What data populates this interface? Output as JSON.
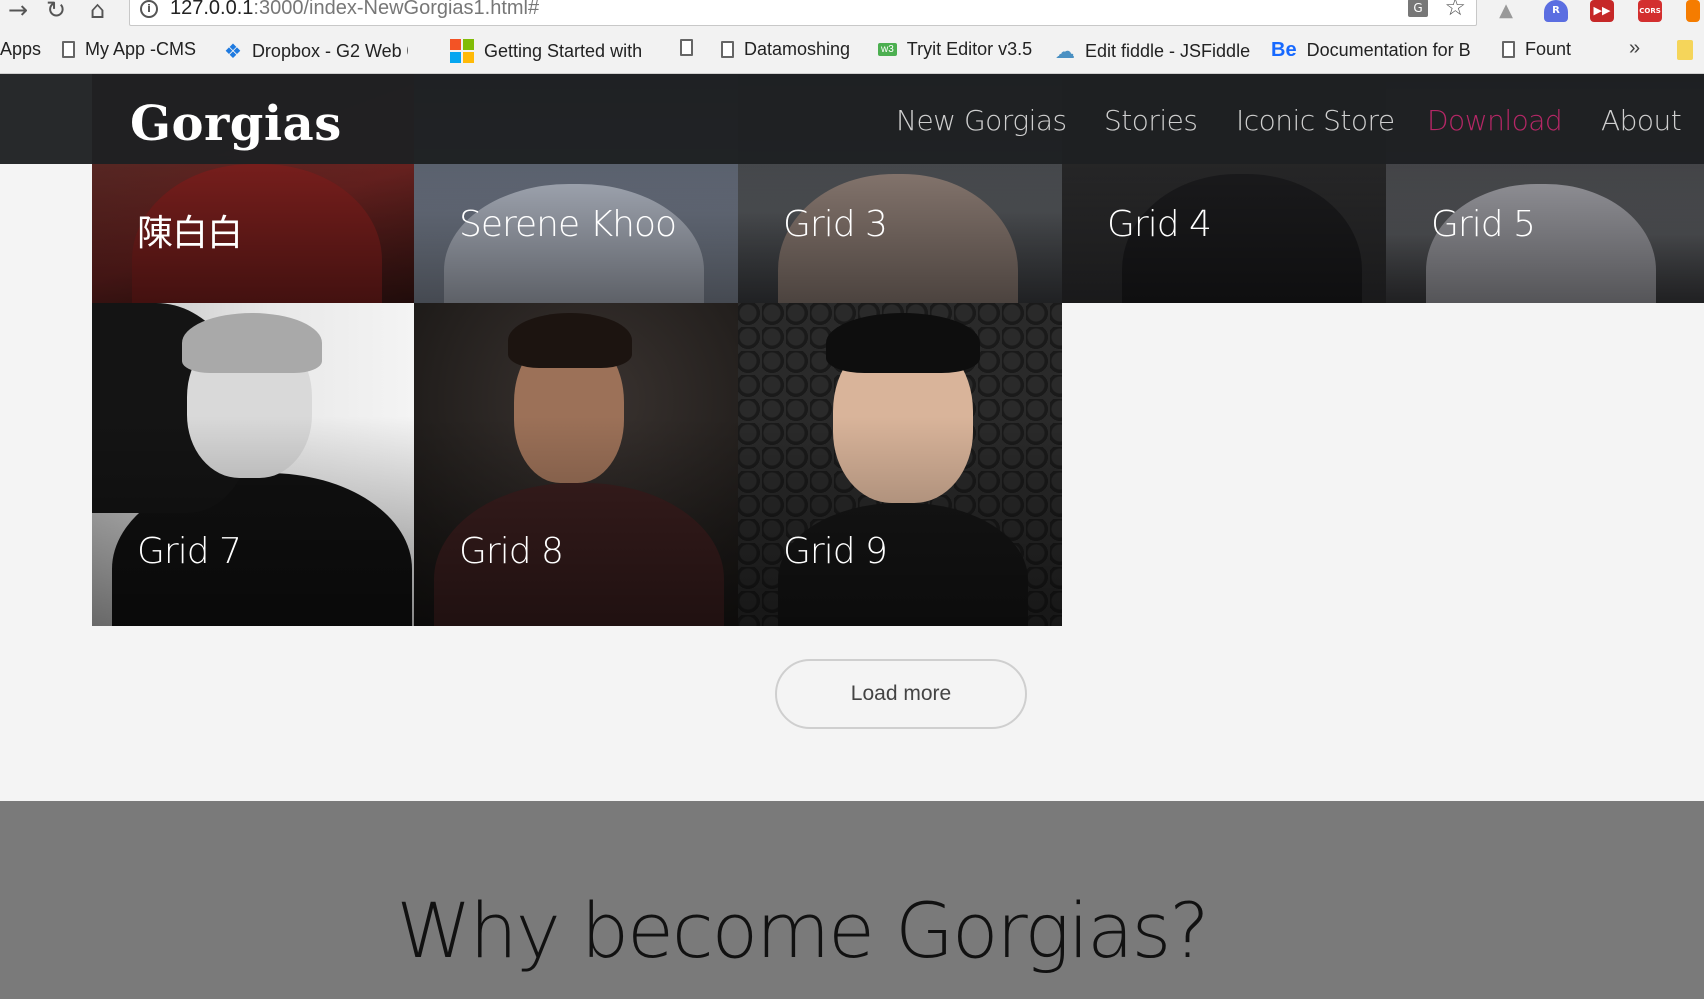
{
  "browser": {
    "url_host": "127.0.0.1",
    "url_path": ":3000/index-NewGorgias1.html#",
    "bookmarks": [
      {
        "label": "Apps",
        "icon": "apps-icon"
      },
      {
        "label": "My App -CMS",
        "icon": "page-icon"
      },
      {
        "label": "Dropbox - G2 Web 0",
        "icon": "dropbox-icon"
      },
      {
        "label": "Getting Started with",
        "icon": "windows-icon"
      },
      {
        "label": "",
        "icon": "page-icon"
      },
      {
        "label": "Datamoshing",
        "icon": "page-icon"
      },
      {
        "label": "Tryit Editor v3.5",
        "icon": "w3-icon"
      },
      {
        "label": "Edit fiddle - JSFiddle",
        "icon": "cloud-icon"
      },
      {
        "label": "Documentation for B",
        "icon": "behance-icon"
      },
      {
        "label": "Fount",
        "icon": "page-icon"
      }
    ],
    "more": "»",
    "extensions": [
      "drive-icon",
      "r-extension-icon",
      "video-extension-icon",
      "cors-extension-icon"
    ],
    "extension_labels": {
      "r": "R",
      "cors": "CORS"
    }
  },
  "site": {
    "logo": "Gorgias",
    "nav": [
      "New Gorgias",
      "Stories",
      "Iconic Store",
      "Download",
      "About"
    ],
    "active_nav": "Download",
    "accent": "#b52766"
  },
  "grid": {
    "row1": [
      "陳白白",
      "Serene Khoo",
      "Grid 3",
      "Grid 4",
      "Grid 5"
    ],
    "row2": [
      "Grid 7",
      "Grid 8",
      "Grid 9"
    ]
  },
  "load_more": "Load more",
  "why": {
    "title": "Why become Gorgias?"
  }
}
